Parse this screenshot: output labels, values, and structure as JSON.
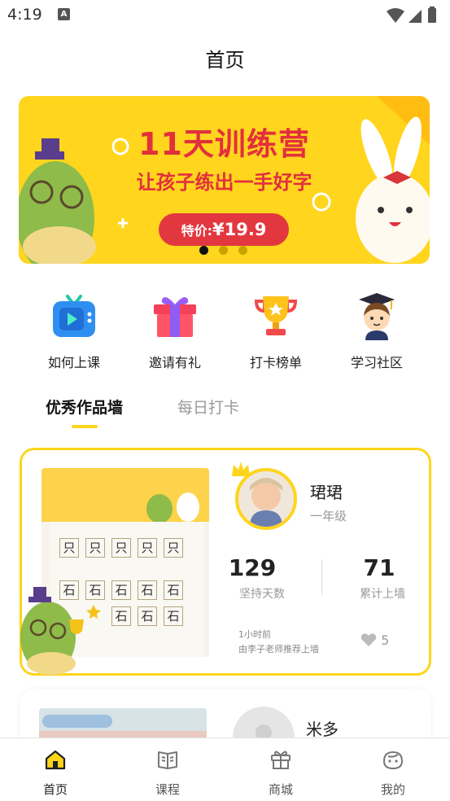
{
  "status_bar": {
    "time": "4:19",
    "notification_icon": "A"
  },
  "header": {
    "title": "首页"
  },
  "banner": {
    "title": "11天训练营",
    "subtitle": "让孩子练出一手好字",
    "price_label": "特价:",
    "price": "¥19.9",
    "active_dot": 0,
    "dot_count": 3
  },
  "quick_links": [
    {
      "label": "如何上课",
      "icon": "tv-play-icon"
    },
    {
      "label": "邀请有礼",
      "icon": "gift-icon"
    },
    {
      "label": "打卡榜单",
      "icon": "trophy-icon"
    },
    {
      "label": "学习社区",
      "icon": "student-avatar-icon"
    }
  ],
  "tabs": [
    {
      "label": "优秀作品墙",
      "active": true
    },
    {
      "label": "每日打卡",
      "active": false
    }
  ],
  "feed": [
    {
      "name": "珺珺",
      "grade": "一年级",
      "days_num": "129",
      "days_label": "坚持天数",
      "wall_num": "71",
      "wall_label": "累计上墙",
      "time": "1小时前",
      "recommend": "由李子老师推荐上墙",
      "likes": "5"
    },
    {
      "name": "米多"
    }
  ],
  "tabbar": [
    {
      "label": "首页",
      "icon": "home-icon",
      "active": true
    },
    {
      "label": "课程",
      "icon": "book-icon",
      "active": false
    },
    {
      "label": "商城",
      "icon": "shop-gift-icon",
      "active": false
    },
    {
      "label": "我的",
      "icon": "profile-face-icon",
      "active": false
    }
  ],
  "colors": {
    "accent_yellow": "#fed51b",
    "banner_red": "#e2303d"
  }
}
